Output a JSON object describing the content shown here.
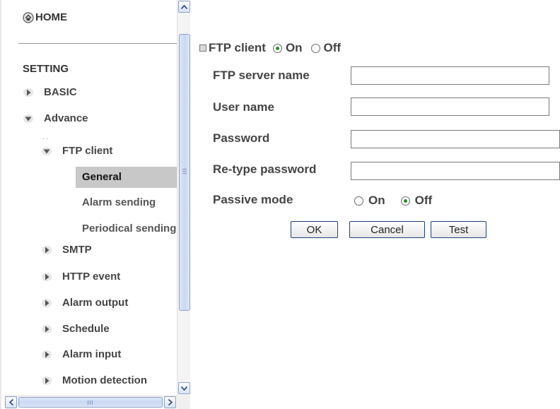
{
  "nav": {
    "home_label": "HOME",
    "setting_label": "SETTING",
    "items": [
      {
        "label": "BASIC",
        "icon": "triangle-right-icon"
      },
      {
        "label": "Advance",
        "icon": "triangle-down-icon"
      },
      {
        "label": "FTP client",
        "icon": "triangle-down-icon"
      },
      {
        "label": "SMTP",
        "icon": "triangle-right-icon"
      },
      {
        "label": "HTTP event",
        "icon": "triangle-right-icon"
      },
      {
        "label": "Alarm output",
        "icon": "triangle-right-icon"
      },
      {
        "label": "Schedule",
        "icon": "triangle-right-icon"
      },
      {
        "label": "Alarm input",
        "icon": "triangle-right-icon"
      },
      {
        "label": "Motion detection",
        "icon": "triangle-right-icon"
      }
    ],
    "ftp_subitems": [
      "General",
      "Alarm sending",
      "Periodical sending"
    ],
    "selected_subitem": "General"
  },
  "form": {
    "section_label": "FTP client",
    "ftp_client_on_label": "On",
    "ftp_client_off_label": "Off",
    "ftp_client_value": "On",
    "fields": [
      {
        "label": "FTP server name",
        "value": ""
      },
      {
        "label": "User name",
        "value": ""
      },
      {
        "label": "Password",
        "value": ""
      },
      {
        "label": "Re-type password",
        "value": ""
      }
    ],
    "passive_mode_label": "Passive mode",
    "passive_on_label": "On",
    "passive_off_label": "Off",
    "passive_mode_value": "Off"
  },
  "buttons": {
    "ok": "OK",
    "cancel": "Cancel",
    "test": "Test"
  },
  "colors": {
    "selected_bg": "#c8c8c8",
    "radio_dot": "#2e8b2e",
    "button_border": "#1f3f7a"
  }
}
